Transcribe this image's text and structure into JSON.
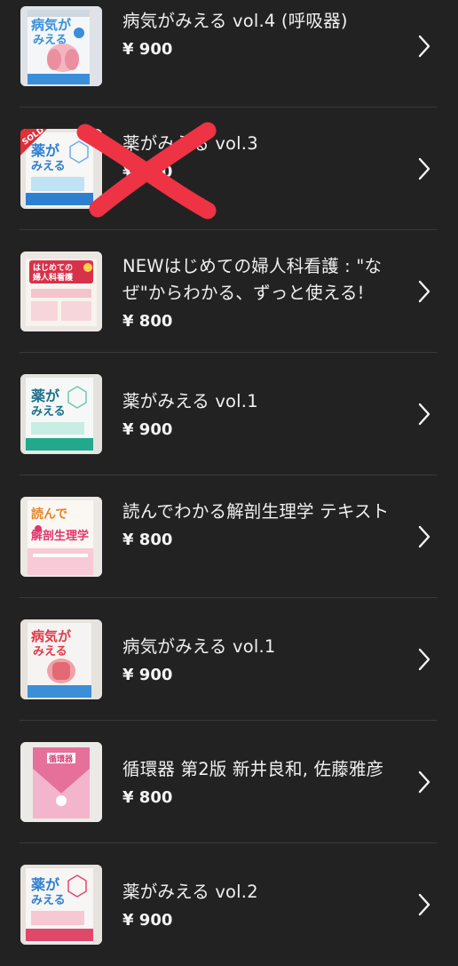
{
  "colors": {
    "background": "#222222",
    "divider": "#3a3a3a",
    "text": "#f0f0f0",
    "chevron": "#f5f5f5",
    "sold_ribbon": "#e0303a",
    "cross_mark": "#ee3344"
  },
  "items": [
    {
      "title": "病気がみえる vol.4 (呼吸器)",
      "price": "¥ 900",
      "icon": "chevron-right-icon",
      "cover": {
        "top_text": "病気が",
        "sub_text": "みえる",
        "theme": "#3b8fd8"
      }
    },
    {
      "title": "薬がみえる vol.3",
      "price": "¥ 900",
      "icon": "chevron-right-icon",
      "sold": true,
      "sold_label": "SOLD",
      "cover": {
        "top_text": "薬が",
        "sub_text": "みえる",
        "theme": "#2f7fd0"
      }
    },
    {
      "title": "NEWはじめての婦人科看護 : \"なぜ\"からわかる、ずっと使える!",
      "price": "¥ 800",
      "icon": "chevron-right-icon",
      "cover": {
        "top_text": "はじめての",
        "sub_text": "婦人科看護",
        "theme": "#d8324a"
      }
    },
    {
      "title": "薬がみえる vol.1",
      "price": "¥ 900",
      "icon": "chevron-right-icon",
      "cover": {
        "top_text": "薬が",
        "sub_text": "みえる",
        "theme": "#22a98c"
      }
    },
    {
      "title": "読んでわかる解剖生理学 テキスト",
      "price": "¥ 800",
      "icon": "chevron-right-icon",
      "cover": {
        "top_text": "読んで",
        "sub_text": "解剖生理学",
        "theme": "#e2356b"
      }
    },
    {
      "title": "病気がみえる vol.1",
      "price": "¥ 900",
      "icon": "chevron-right-icon",
      "cover": {
        "top_text": "病気が",
        "sub_text": "みえる",
        "theme": "#e23a4a"
      }
    },
    {
      "title": "循環器 第2版 新井良和, 佐藤雅彦",
      "price": "¥ 800",
      "icon": "chevron-right-icon",
      "cover": {
        "top_text": "循環器",
        "sub_text": "",
        "theme": "#e5709a"
      }
    },
    {
      "title": "薬がみえる vol.2",
      "price": "¥ 900",
      "icon": "chevron-right-icon",
      "cover": {
        "top_text": "薬が",
        "sub_text": "みえる",
        "theme": "#e0486a"
      }
    }
  ]
}
